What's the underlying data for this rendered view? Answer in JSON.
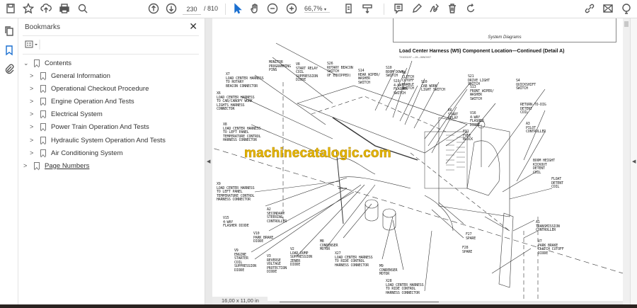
{
  "toolbar": {
    "current_page": "230",
    "total_pages": "/ 810",
    "zoom": "66,7%",
    "icons": [
      "save-icon",
      "star-icon",
      "upload-icon",
      "print-icon",
      "search-icon",
      "page-up-icon",
      "page-down-icon",
      "select-cursor-icon",
      "hand-icon",
      "zoom-out-icon",
      "zoom-in-icon",
      "fit-page-icon",
      "scroll-mode-icon",
      "comment-icon",
      "pen-icon",
      "sign-icon",
      "delete-icon",
      "rotate-icon",
      "share-link-icon",
      "mail-icon",
      "account-icon"
    ]
  },
  "sidebar": {
    "title": "Bookmarks",
    "items": [
      {
        "label": "Contents",
        "expanded": true,
        "level": 0
      },
      {
        "label": "General Information",
        "level": 1
      },
      {
        "label": "Operational Checkout Procedure",
        "level": 1
      },
      {
        "label": "Engine Operation And Tests",
        "level": 1
      },
      {
        "label": "Electrical System",
        "level": 1
      },
      {
        "label": "Power Train Operation And Tests",
        "level": 1
      },
      {
        "label": "Hydraulic System Operation And Tests",
        "level": 1
      },
      {
        "label": "Air Conditioning System",
        "level": 1
      },
      {
        "label": "Page Numbers",
        "level": 0
      }
    ]
  },
  "document": {
    "header": "System Diagrams",
    "title": "Load Center Harness (W5) Component Location—Continued (Detail A)",
    "subtitle": "TX1031197 —19—06NOV07",
    "watermark": "machinecatalogic.com",
    "page_size": "16,00 x 11,00 in",
    "labels": [
      "MONITOR\nPROGRAMMING\nPINS",
      "V8\nSTART RELAY\nCOIL\nSUPPRESSION\nDIODE",
      "S26\nROTARY BEACON\nSWITCH\nOF EQUIPPED)",
      "S14\nREAR WIPER/\nWASHER\nSWITCH",
      "S10\nBOOM DOWN\nSWITCH",
      "S6\nCLUTCH\nCUTOFF\nENABLE\nSWITCH",
      "S19\n4-WAY\nFLASHER\nSWITCH",
      "S20\nCAB WORK\nLIGHT SWITCH",
      "X7\nLOAD CENTER HARNESS\nTO ROTARY\nBEACON CONNECTOR",
      "X6\nLOAD CENTER HARNESS\nTO CAB/CANOPY WORK\nLIGHTS HARNESS\nCONNECTOR",
      "X8\nLOAD CENTER HARNESS\nTO LEFT PANEL\nTEMPERATURE CONTROL\nHARNESS CONNECTOR",
      "S21\nDRIVE LIGHT\nSWITCH",
      "S13\nFRONT WIPER/\nWASHER\nSWITCH",
      "S4\nQUICKSHIFT\nSWITCH",
      "K6\nSTART\nRELAY",
      "V16\n4-WAY\nFLASHER\nDIODE",
      "RETURN-TO-DIG\nDETENT\nCOIL",
      "A3\nPILOT\nCONTROLLER",
      "F31\nFUSE\nBLOCK",
      "BOOM HEIGHT\nKICKOUT\nDETENT\nCOIL",
      "FLOAT\nDETENT\nCOIL",
      "X9\nLOAD CENTER HARNESS\nTO LEFT PANEL\nTEMPERATURE CONTROL\nHARNESS CONNECTOR",
      "A2\nSECONDARY\nSTEERING\nCONTROLLER",
      "V15\n4-WAY\nFLASHER DIODE",
      "V10\nPARK BRAKE\nDIODE",
      "V9\nENGINE\nSTARTER\nCOIL\nSUPPRESSION\nDIODE",
      "V3\nREVERSE\nVOLTAGE\nPROTECTION\nDIODE",
      "V2\nLOAD DUMP\nSUPPRESSION\nZENER\nDIODE",
      "M8\nCONDENSER\nMOTOR",
      "X27\nLOAD CENTER HARNESS\nTO RIDE CONTROL\nHARNESS CONNECTOR",
      "M9\nCONDENSER\nMOTOR",
      "X28\nLOAD CENTER HARNESS\nTO RIDE CONTROL\nHARNESS CONNECTOR",
      "F27\nSPARE",
      "F28\nSPARE",
      "A1\nTRANSMISSION\nCONTROLLER",
      "V7\nPARK BRAKE\nCLUTCH CUTOFF\nDIODE"
    ]
  },
  "colors": {
    "accent": "#1a6fd0",
    "watermark": "#e7b800"
  }
}
